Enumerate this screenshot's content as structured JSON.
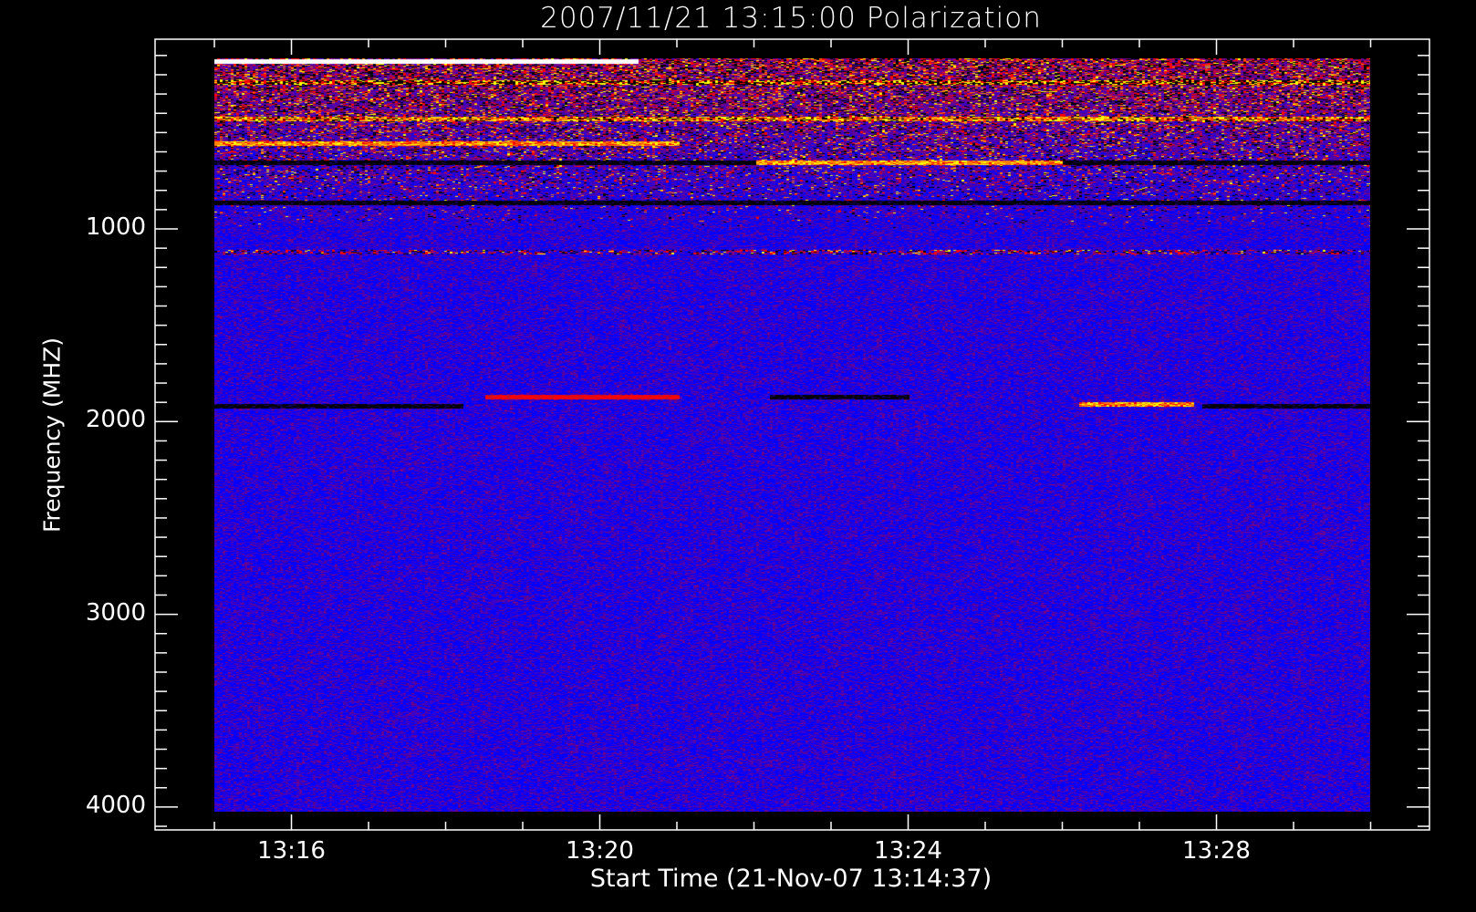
{
  "chart_data": {
    "type": "heatmap",
    "title": "2007/11/21 13:15:00 Polarization",
    "xlabel": "Start Time (21-Nov-07 13:14:37)",
    "ylabel": "Frequency (MHZ)",
    "x_range_minutes": [
      "13:15",
      "13:30"
    ],
    "y_range_mhz": [
      115,
      4020
    ],
    "y_inverted": true,
    "x_ticks": [
      {
        "label": "13:16",
        "minute": 1
      },
      {
        "label": "13:20",
        "minute": 5
      },
      {
        "label": "13:24",
        "minute": 9
      },
      {
        "label": "13:28",
        "minute": 13
      }
    ],
    "y_ticks": [
      {
        "label": "1000",
        "value": 1000
      },
      {
        "label": "2000",
        "value": 2000
      },
      {
        "label": "3000",
        "value": 3000
      },
      {
        "label": "4000",
        "value": 4000
      }
    ],
    "colormap": [
      "#000000",
      "#0000ff",
      "#7f007f",
      "#ff0000",
      "#ff8000",
      "#ffff00",
      "#ffffff"
    ],
    "features": [
      {
        "freq": 130,
        "t0": 0,
        "t1": 5.5,
        "kind": "white"
      },
      {
        "freq": 240,
        "t0": 0,
        "t1": 15,
        "kind": "mixed"
      },
      {
        "freq": 425,
        "t0": 0,
        "t1": 15,
        "kind": "bright"
      },
      {
        "freq": 555,
        "t0": 0,
        "t1": 6,
        "kind": "orange"
      },
      {
        "freq": 655,
        "t0": 0,
        "t1": 15,
        "kind": "black"
      },
      {
        "freq": 655,
        "t0": 7,
        "t1": 11,
        "kind": "orange"
      },
      {
        "freq": 865,
        "t0": 0,
        "t1": 15,
        "kind": "black"
      },
      {
        "freq": 1120,
        "t0": 0,
        "t1": 15,
        "kind": "speckle"
      },
      {
        "freq": 1870,
        "t0": 3.5,
        "t1": 6,
        "kind": "red"
      },
      {
        "freq": 1870,
        "t0": 7.2,
        "t1": 9,
        "kind": "black"
      },
      {
        "freq": 1910,
        "t0": 11.2,
        "t1": 12.7,
        "kind": "orange"
      },
      {
        "freq": 1920,
        "t0": 0,
        "t1": 3.2,
        "kind": "black"
      },
      {
        "freq": 1920,
        "t0": 12.8,
        "t1": 15,
        "kind": "black"
      }
    ]
  }
}
